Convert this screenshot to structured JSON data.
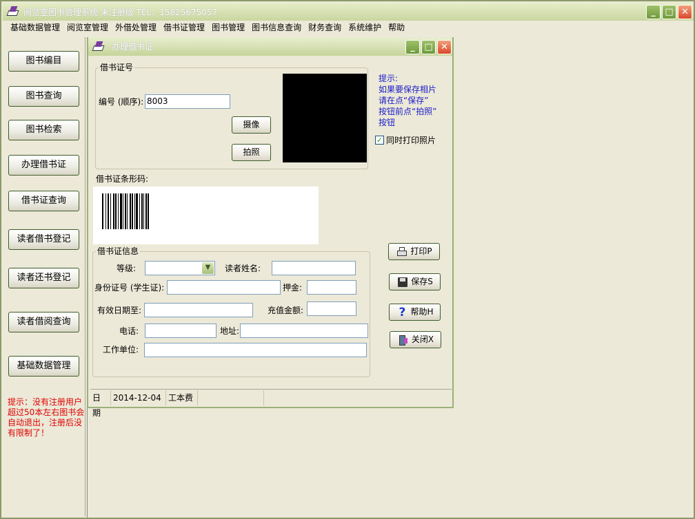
{
  "window": {
    "title": "阅览室图书管理系统 未注册版  TEL：15825675057"
  },
  "menu": [
    "基础数据管理",
    "阅览室管理",
    "外借处管理",
    "借书证管理",
    "图书管理",
    "图书信息查询",
    "财务查询",
    "系统维护",
    "帮助"
  ],
  "sidebar": {
    "buttons": [
      "图书编目",
      "图书查询",
      "图书检索",
      "办理借书证",
      "借书证查询",
      "读者借书登记",
      "读者还书登记",
      "读者借阅查询",
      "基础数据管理"
    ],
    "note": "提示：没有注册用户超过50本左右图书会自动退出，注册后没有限制了！"
  },
  "child": {
    "title": "办理借书证",
    "card_group": {
      "legend": "借书证号",
      "number_label": "编号 (顺序):",
      "number_value": "8003",
      "camera_button": "摄像",
      "photo_button": "拍照"
    },
    "hint": "提示:\n如果要保存相片\n请在点“保存”\n按钮前点“拍照”\n按钮",
    "print_photo_checkbox": {
      "label": "同时打印照片",
      "checked": true
    },
    "barcode_label": "借书证条形码:",
    "info_group": {
      "legend": "借书证信息",
      "level_label": "等级:",
      "reader_name_label": "读者姓名:",
      "id_label": "身份证号 (学生证):",
      "deposit_label": "押金:",
      "valid_label": "有效日期至:",
      "recharge_label": "充值金额:",
      "phone_label": "电话:",
      "address_label": "地址:",
      "work_label": "工作单位:"
    },
    "actions": {
      "print": "打印P",
      "save": "保存S",
      "help": "帮助H",
      "close": "关闭X"
    },
    "status": {
      "date_label": "日期",
      "date_value": "2014-12-04",
      "fee_label": "工本费"
    }
  }
}
